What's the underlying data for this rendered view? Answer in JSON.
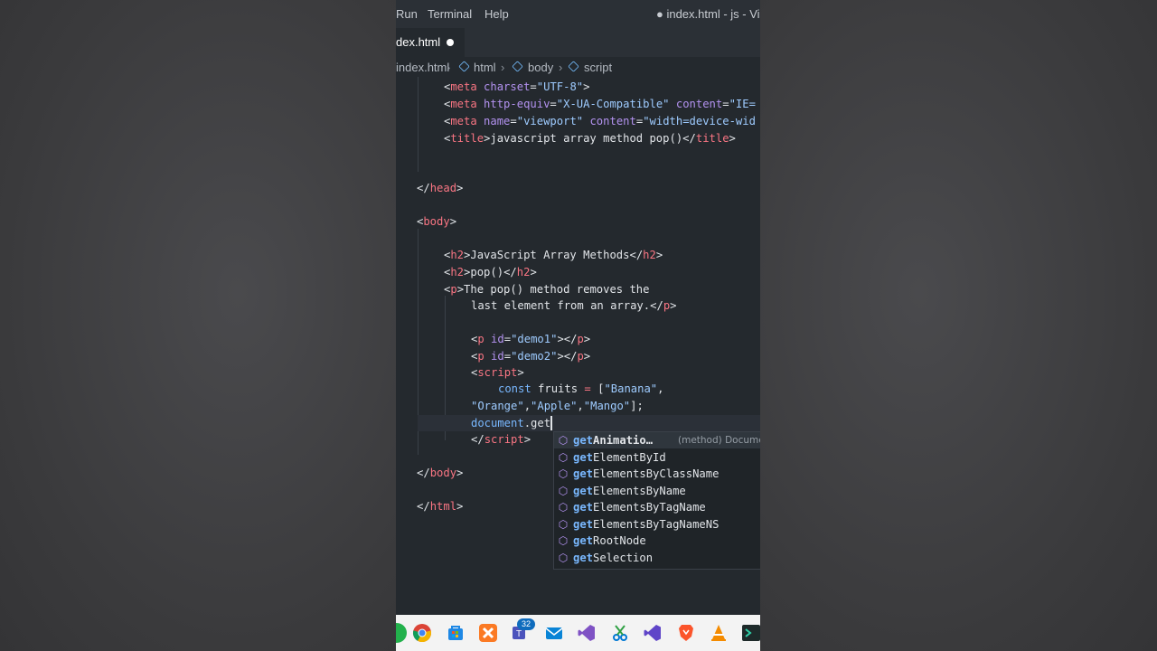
{
  "menu": {
    "items": [
      "Run",
      "Terminal",
      "Help"
    ],
    "window_title": "● index.html - js - Visu"
  },
  "tab": {
    "label": "dex.html",
    "modified_icon": "dot-icon"
  },
  "breadcrumb": {
    "items": [
      "index.html",
      "html",
      "body",
      "script"
    ]
  },
  "code": {
    "meta1": {
      "tag": "meta",
      "attr": "charset",
      "value": "\"UTF-8\""
    },
    "meta2": {
      "tag": "meta",
      "attr": "http-equiv",
      "value": "\"X-UA-Compatible\"",
      "attr2": "content",
      "value2": "\"IE="
    },
    "meta3": {
      "tag": "meta",
      "attr": "name",
      "value": "\"viewport\"",
      "attr2": "content",
      "value2": "\"width=device-wid"
    },
    "title": {
      "tag": "title",
      "text": "javascript array method pop()"
    },
    "head_close": "head",
    "body_open": "body",
    "h2_1": {
      "tag": "h2",
      "text": "JavaScript Array Methods"
    },
    "h2_2": {
      "tag": "h2",
      "text": "pop()"
    },
    "p_text_1": "The pop() method removes the",
    "p_text_2": "last element from an array.",
    "p_tag": "p",
    "demo1": {
      "attr": "id",
      "value": "\"demo1\""
    },
    "demo2": {
      "attr": "id",
      "value": "\"demo2\""
    },
    "script_tag": "script",
    "const_kw": "const",
    "fruits_decl": "fruits",
    "fruit1": "\"Banana\"",
    "fruit2": "\"Orange\"",
    "fruit3": "\"Apple\"",
    "fruit4": "\"Mango\"",
    "doc_obj": "document",
    "typed": "get",
    "script_close": "script",
    "body_close": "body",
    "html_close": "html"
  },
  "suggestions": {
    "items": [
      {
        "match": "get",
        "rest": "Animatio…",
        "detail": "(method) Docume",
        "selected": true
      },
      {
        "match": "get",
        "rest": "ElementById"
      },
      {
        "match": "get",
        "rest": "ElementsByClassName"
      },
      {
        "match": "get",
        "rest": "ElementsByName"
      },
      {
        "match": "get",
        "rest": "ElementsByTagName"
      },
      {
        "match": "get",
        "rest": "ElementsByTagNameNS"
      },
      {
        "match": "get",
        "rest": "RootNode"
      },
      {
        "match": "get",
        "rest": "Selection"
      }
    ],
    "icon": "method-cube-icon"
  },
  "taskbar": {
    "apps": [
      "chrome-icon",
      "store-icon",
      "xampp-icon",
      "teams-icon",
      "mail-icon",
      "visual-studio-icon",
      "snipping-tool-icon",
      "vscode-icon",
      "brave-icon",
      "vlc-icon",
      "terminal-icon"
    ],
    "teams_badge": "32"
  },
  "colors": {
    "editor_bg": "#24292e",
    "tag": "#f97583",
    "attr": "#b392f0",
    "string": "#9ecbff",
    "keyword": "#79b8ff"
  }
}
